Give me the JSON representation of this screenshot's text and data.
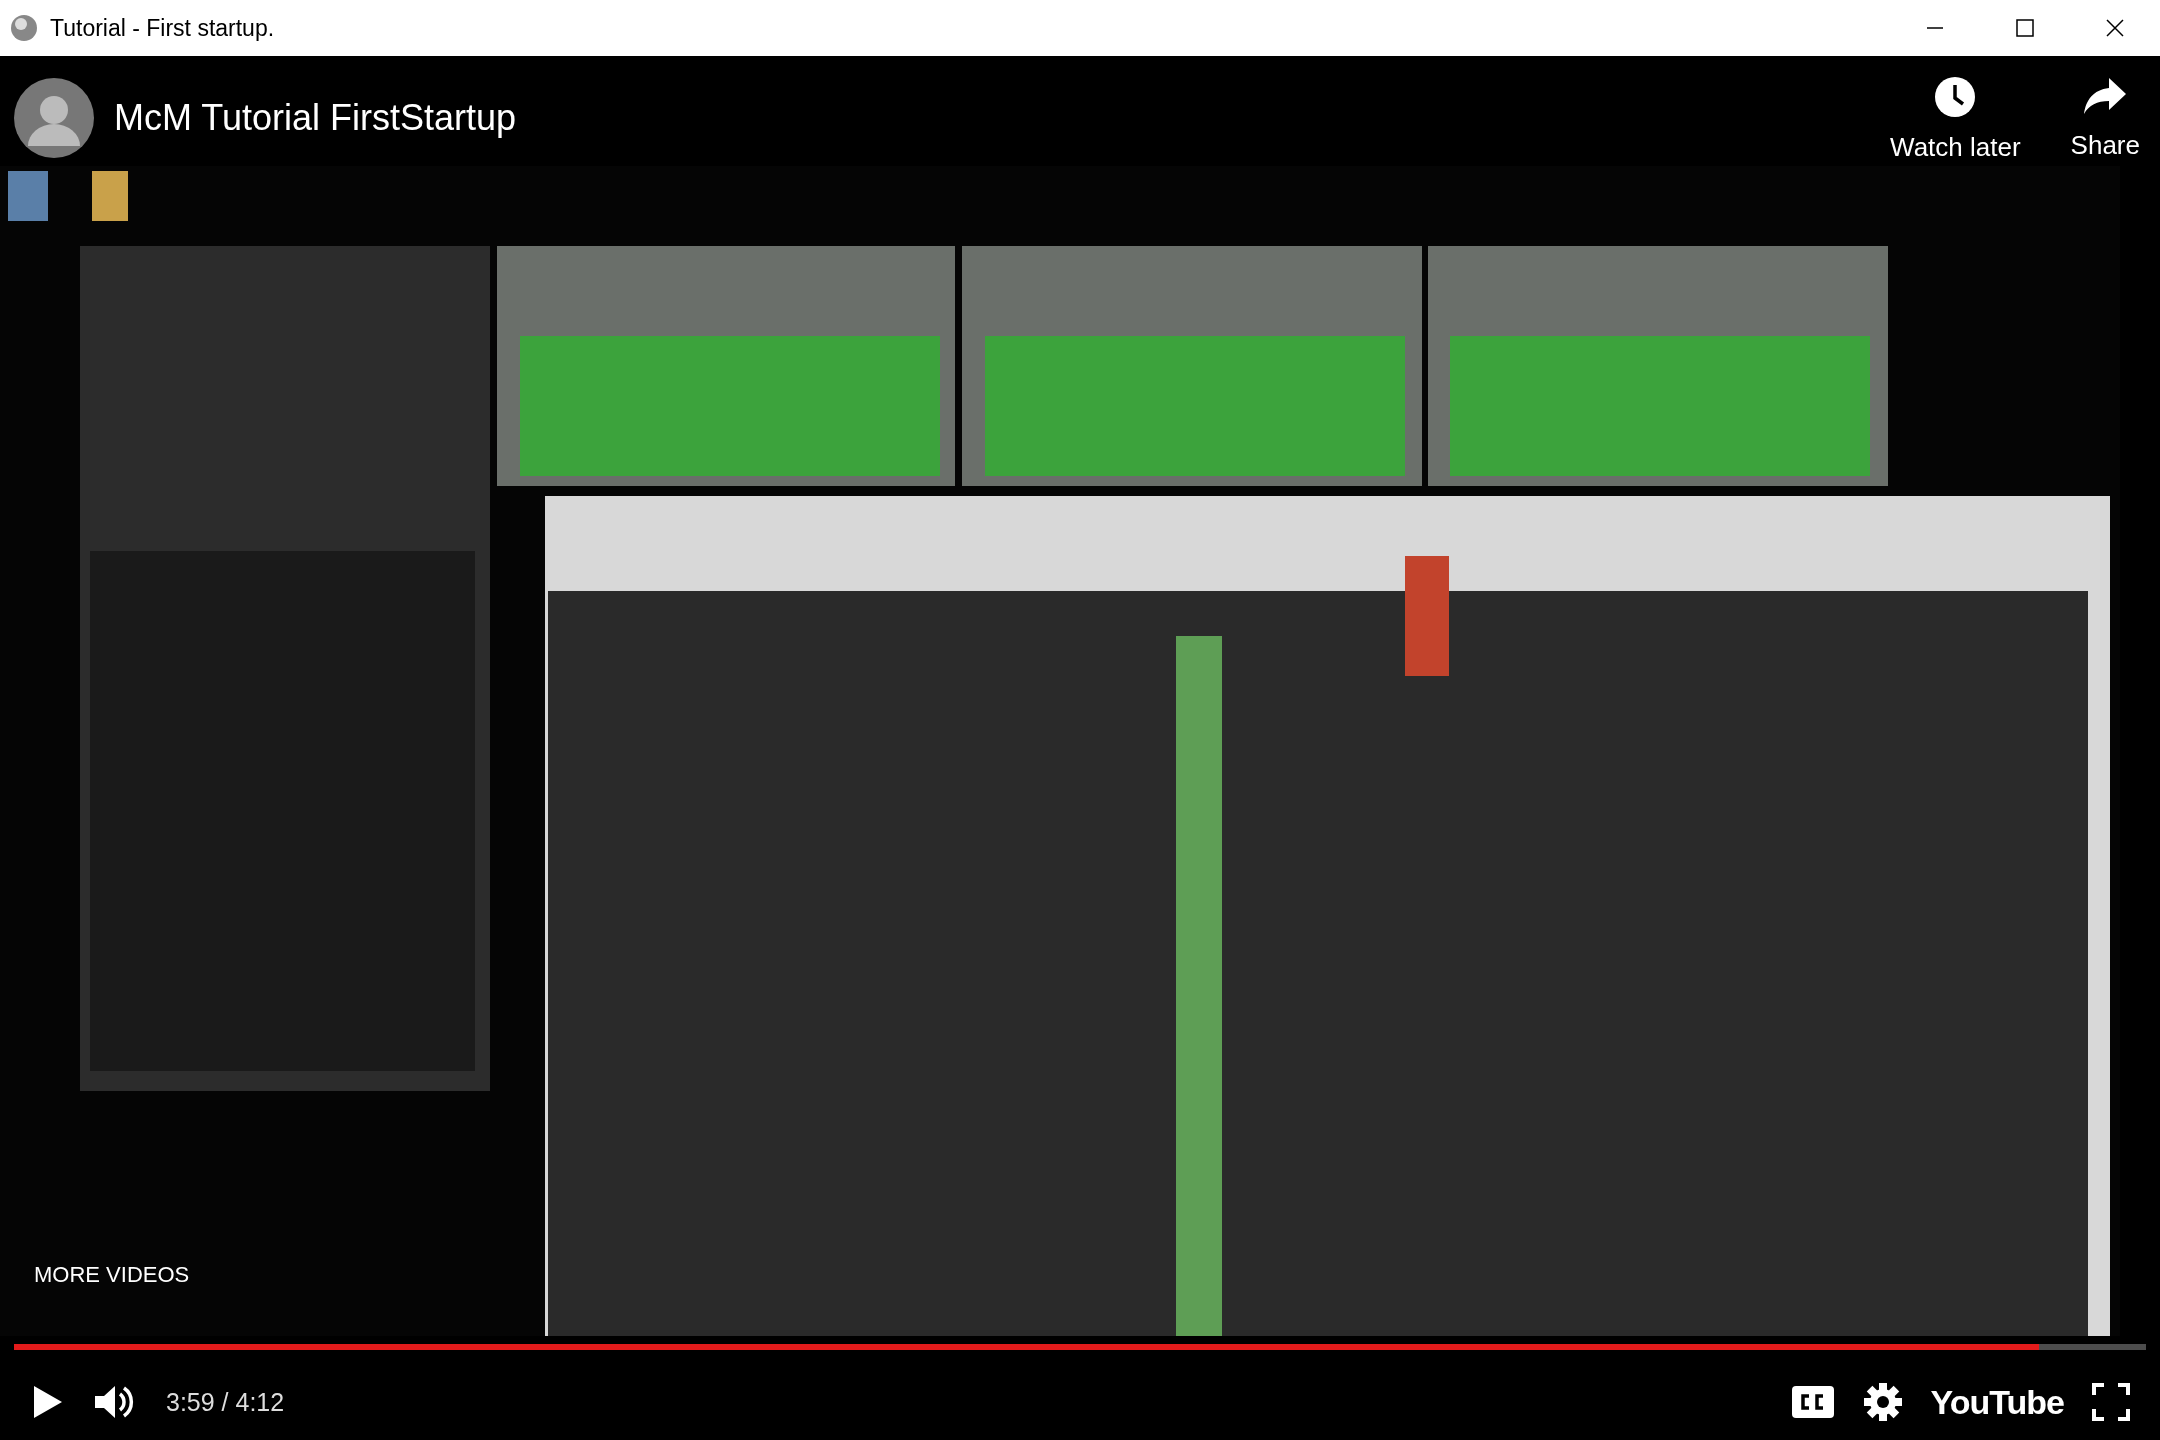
{
  "window": {
    "title": "Tutorial - First startup."
  },
  "video": {
    "kind": "picture",
    "title": "McM Tutorial FirstStartup"
  },
  "actions": [
    {
      "kind": "clock",
      "label": "Watch later"
    },
    {
      "kind": "share",
      "label": "Share"
    }
  ],
  "more_videos": "MORE VIDEOS",
  "progress": {
    "level": 0.95
  },
  "player": {
    "time": "3:59 / 4:12",
    "logo": "YouTube"
  }
}
